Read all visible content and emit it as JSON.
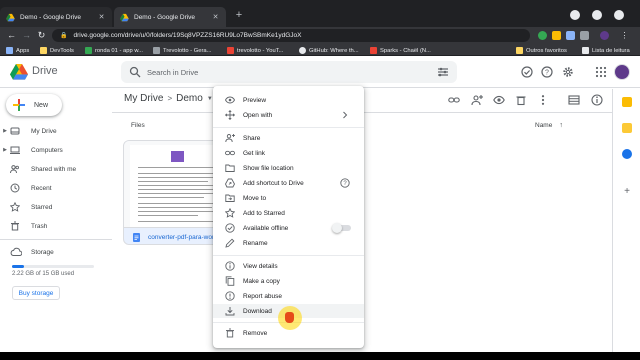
{
  "browser": {
    "tabs": [
      {
        "title": "Demo - Google Drive",
        "active": false
      },
      {
        "title": "Demo - Google Drive",
        "active": true
      }
    ],
    "new_tab": "+",
    "url": "drive.google.com/drive/u/0/folders/19Sq8VPZZS16RU9Lo7BwSBmKe1ydGJoX",
    "bookmarks": [
      {
        "label": "Apps",
        "icon": "apps-grid-icon",
        "color": "#8ab4f8"
      },
      {
        "label": "DevTools",
        "icon": "folder-icon",
        "color": "#fdd663"
      },
      {
        "label": "ronda 01 - app w...",
        "icon": "sheet-icon",
        "color": "#34a853"
      },
      {
        "label": "Trevolotto - Gera...",
        "icon": "site-icon",
        "color": "#9aa0a6"
      },
      {
        "label": "trevolotto - YouT...",
        "icon": "youtube-icon",
        "color": "#ea4335"
      },
      {
        "label": "GitHub: Where th...",
        "icon": "github-icon",
        "color": "#e8eaed"
      },
      {
        "label": "Sparks - Chaël (N...",
        "icon": "youtube-icon",
        "color": "#ea4335"
      },
      {
        "label": "Outros favoritos",
        "icon": "folder-icon",
        "color": "#fdd663"
      },
      {
        "label": "Lista de leitura",
        "icon": "reading-list-icon",
        "color": "#e8eaed"
      }
    ]
  },
  "drive": {
    "product_name": "Drive",
    "search_placeholder": "Search in Drive",
    "new_label": "New",
    "sidebar": [
      {
        "label": "My Drive",
        "icon": "my-drive-icon",
        "caret": true
      },
      {
        "label": "Computers",
        "icon": "computer-icon",
        "caret": true
      },
      {
        "label": "Shared with me",
        "icon": "shared-icon",
        "caret": false
      },
      {
        "label": "Recent",
        "icon": "clock-icon",
        "caret": false
      },
      {
        "label": "Starred",
        "icon": "star-icon",
        "caret": false
      },
      {
        "label": "Trash",
        "icon": "trash-icon",
        "caret": false
      }
    ],
    "storage_label": "Storage",
    "storage_used_text": "2.22 GB of 15 GB used",
    "storage_fraction": 0.148,
    "buy_storage": "Buy storage",
    "breadcrumb": {
      "root": "My Drive",
      "separator": ">",
      "current": "Demo"
    },
    "files_label": "Files",
    "name_sort_label": "Name",
    "sort_arrow": "↑",
    "file": {
      "name": "converter-pdf-para-word",
      "type_icon": "docs-icon"
    }
  },
  "context_menu": {
    "items": [
      {
        "label": "Preview",
        "icon": "eye-icon"
      },
      {
        "label": "Open with",
        "icon": "open-with-icon",
        "trailing": "chevron-right-icon"
      },
      {
        "divider": true
      },
      {
        "label": "Share",
        "icon": "person-add-icon"
      },
      {
        "label": "Get link",
        "icon": "link-icon"
      },
      {
        "label": "Show file location",
        "icon": "folder-icon"
      },
      {
        "label": "Add shortcut to Drive",
        "icon": "drive-shortcut-icon",
        "trailing": "help-icon"
      },
      {
        "label": "Move to",
        "icon": "move-to-icon"
      },
      {
        "label": "Add to Starred",
        "icon": "star-icon"
      },
      {
        "label": "Available offline",
        "icon": "offline-icon",
        "trailing": "toggle"
      },
      {
        "label": "Rename",
        "icon": "pencil-icon"
      },
      {
        "divider": true
      },
      {
        "label": "View details",
        "icon": "info-icon"
      },
      {
        "label": "Make a copy",
        "icon": "copy-icon"
      },
      {
        "label": "Report abuse",
        "icon": "report-icon"
      },
      {
        "label": "Download",
        "icon": "download-icon",
        "hover": true
      },
      {
        "divider": true
      },
      {
        "label": "Remove",
        "icon": "trash-icon"
      }
    ]
  },
  "colors": {
    "accent": "#1a73e8",
    "chrome_dark": "#202124",
    "hover_bg": "#f1f3f4",
    "cursor_highlight": "#ffd600"
  }
}
